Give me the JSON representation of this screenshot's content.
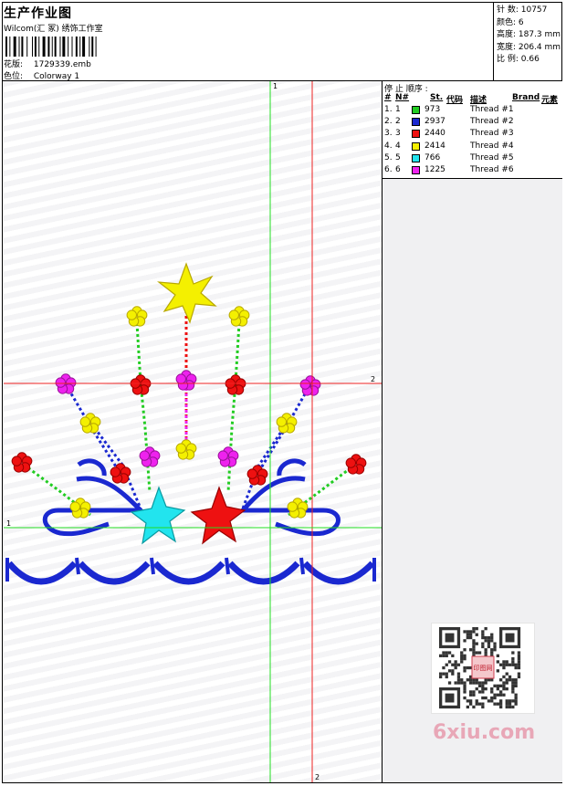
{
  "header": {
    "title": "生产作业图",
    "subtitle": "Wilcom(汇 冢) 绣饰工作室",
    "design_label": "花版:",
    "design_value": "1729339.emb",
    "colorway_label": "色位:",
    "colorway_value": "Colorway 1"
  },
  "stats": {
    "stitches": "针 数: 10757",
    "colors": "颜色: 6",
    "height": "高度: 187.3 mm",
    "width": "宽度: 206.4 mm",
    "scale": "比 例: 0.66"
  },
  "stop_sequence": {
    "title": "停 止 顺序 :",
    "headers": {
      "num": "#",
      "n": "N#",
      "st": "St.",
      "code": "代码",
      "desc": "描述",
      "brand": "Brand",
      "element": "元素"
    },
    "rows": [
      {
        "num": "1.",
        "n": "1",
        "st": "973",
        "desc": "Thread #1",
        "color": "#22cc22"
      },
      {
        "num": "2.",
        "n": "2",
        "st": "2937",
        "desc": "Thread #2",
        "color": "#1a28d0"
      },
      {
        "num": "3.",
        "n": "3",
        "st": "2440",
        "desc": "Thread #3",
        "color": "#ee1111"
      },
      {
        "num": "4.",
        "n": "4",
        "st": "2414",
        "desc": "Thread #4",
        "color": "#f4f000"
      },
      {
        "num": "5.",
        "n": "5",
        "st": "766",
        "desc": "Thread #5",
        "color": "#22e4ee"
      },
      {
        "num": "6.",
        "n": "6",
        "st": "1225",
        "desc": "Thread #6",
        "color": "#ee22ee"
      }
    ]
  },
  "guides": {
    "v1": "1",
    "v2": "2",
    "h1": "1",
    "h2": "2",
    "v1_color": "#22dd22",
    "v2_color": "#ee2222"
  },
  "watermark": {
    "text": "6xiu.com",
    "seal": "印图网"
  },
  "colors": {
    "green": "#22cc22",
    "blue": "#1a28d0",
    "red": "#ee1111",
    "yellow": "#f4f000",
    "cyan": "#22e4ee",
    "magenta": "#ee22ee"
  }
}
